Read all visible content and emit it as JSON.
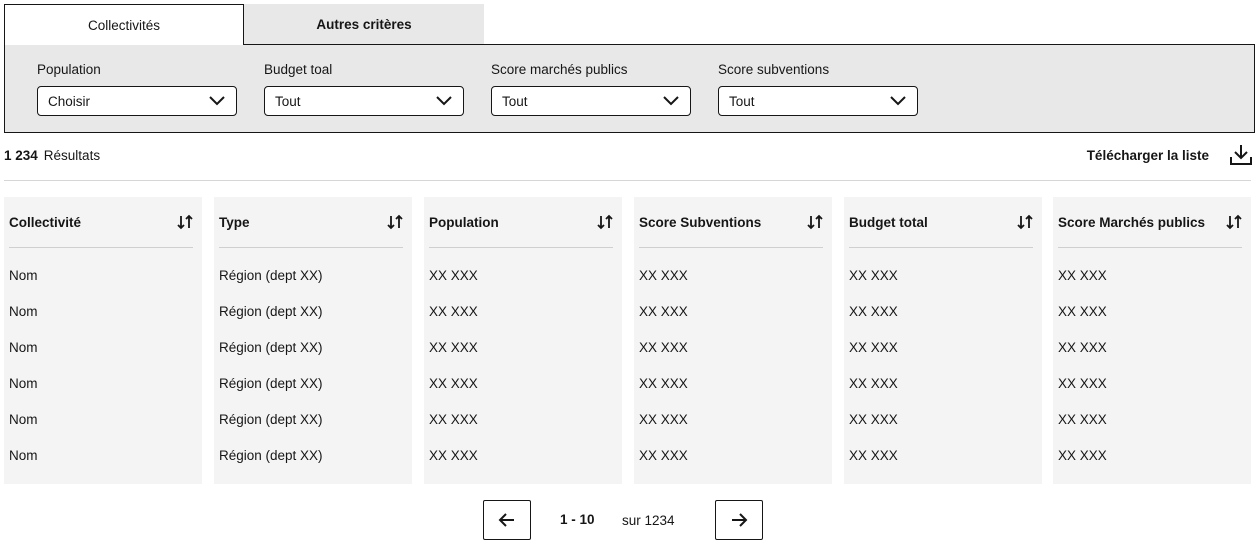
{
  "tabs": [
    {
      "label": "Collectivités",
      "active": true
    },
    {
      "label": "Autres critères",
      "active": false
    }
  ],
  "filters": [
    {
      "label": "Population",
      "value": "Choisir"
    },
    {
      "label": "Budget toal",
      "value": "Tout"
    },
    {
      "label": "Score marchés publics",
      "value": "Tout"
    },
    {
      "label": "Score subventions",
      "value": "Tout"
    }
  ],
  "results": {
    "count": "1 234",
    "label": "Résultats"
  },
  "download": {
    "label": "Télécharger la liste",
    "icon": "download-icon"
  },
  "table": {
    "columns": [
      {
        "header": "Collectivité",
        "cells": [
          "Nom",
          "Nom",
          "Nom",
          "Nom",
          "Nom",
          "Nom"
        ]
      },
      {
        "header": "Type",
        "cells": [
          "Région (dept XX)",
          "Région (dept XX)",
          "Région (dept XX)",
          "Région (dept XX)",
          "Région (dept XX)",
          "Région (dept XX)"
        ]
      },
      {
        "header": "Population",
        "cells": [
          "XX XXX",
          "XX XXX",
          "XX XXX",
          "XX XXX",
          "XX XXX",
          "XX XXX"
        ]
      },
      {
        "header": "Score Subventions",
        "cells": [
          "XX XXX",
          "XX XXX",
          "XX XXX",
          "XX XXX",
          "XX XXX",
          "XX XXX"
        ]
      },
      {
        "header": "Budget total",
        "cells": [
          "XX XXX",
          "XX XXX",
          "XX XXX",
          "XX XXX",
          "XX XXX",
          "XX XXX"
        ]
      },
      {
        "header": "Score Marchés publics",
        "cells": [
          "XX XXX",
          "XX XXX",
          "XX XXX",
          "XX XXX",
          "XX XXX",
          "XX XXX"
        ]
      }
    ]
  },
  "pagination": {
    "range": "1 - 10",
    "total": "sur 1234",
    "prev_icon": "arrow-left-icon",
    "next_icon": "arrow-right-icon"
  }
}
